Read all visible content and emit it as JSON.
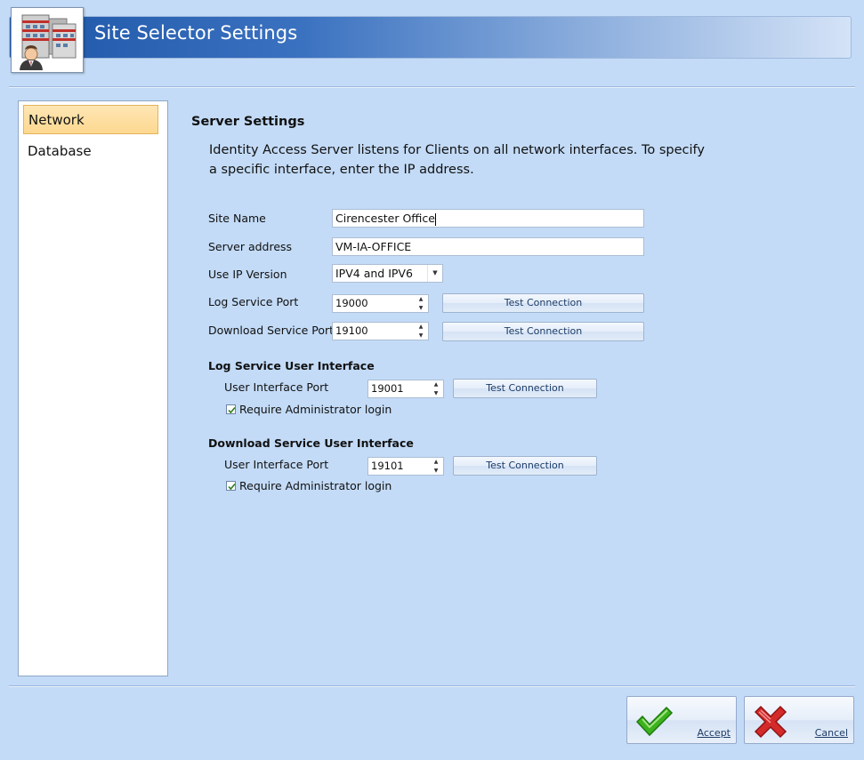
{
  "window": {
    "title": "Site Selector Settings"
  },
  "sidebar": {
    "items": [
      {
        "label": "Network",
        "active": true
      },
      {
        "label": "Database",
        "active": false
      }
    ]
  },
  "server_settings": {
    "title": "Server Settings",
    "description": "Identity Access Server listens for Clients on all network interfaces. To specify a specific interface, enter the IP address.",
    "site_name": {
      "label": "Site Name",
      "value": "Cirencester Office"
    },
    "server_address": {
      "label": "Server address",
      "value": "VM-IA-OFFICE"
    },
    "ip_version": {
      "label": "Use IP Version",
      "value": "IPV4 and IPV6"
    },
    "log_port": {
      "label": "Log Service Port",
      "value": "19000",
      "test_label": "Test Connection"
    },
    "download_port": {
      "label": "Download Service Port",
      "value": "19100",
      "test_label": "Test Connection"
    }
  },
  "log_ui": {
    "title": "Log Service User Interface",
    "port_label": "User Interface  Port",
    "port_value": "19001",
    "test_label": "Test Connection",
    "require_login_label": "Require Administrator login",
    "require_login_checked": true
  },
  "download_ui": {
    "title": "Download Service User Interface",
    "port_label": "User Interface Port",
    "port_value": "19101",
    "test_label": "Test Connection",
    "require_login_label": "Require Administrator login",
    "require_login_checked": true
  },
  "footer": {
    "accept_label": "Accept",
    "cancel_label": "Cancel"
  },
  "colors": {
    "accent": "#1e56a8",
    "accept_check": "#3cb21e",
    "cancel_x": "#d42a2a",
    "selection": "#fedfa0"
  }
}
